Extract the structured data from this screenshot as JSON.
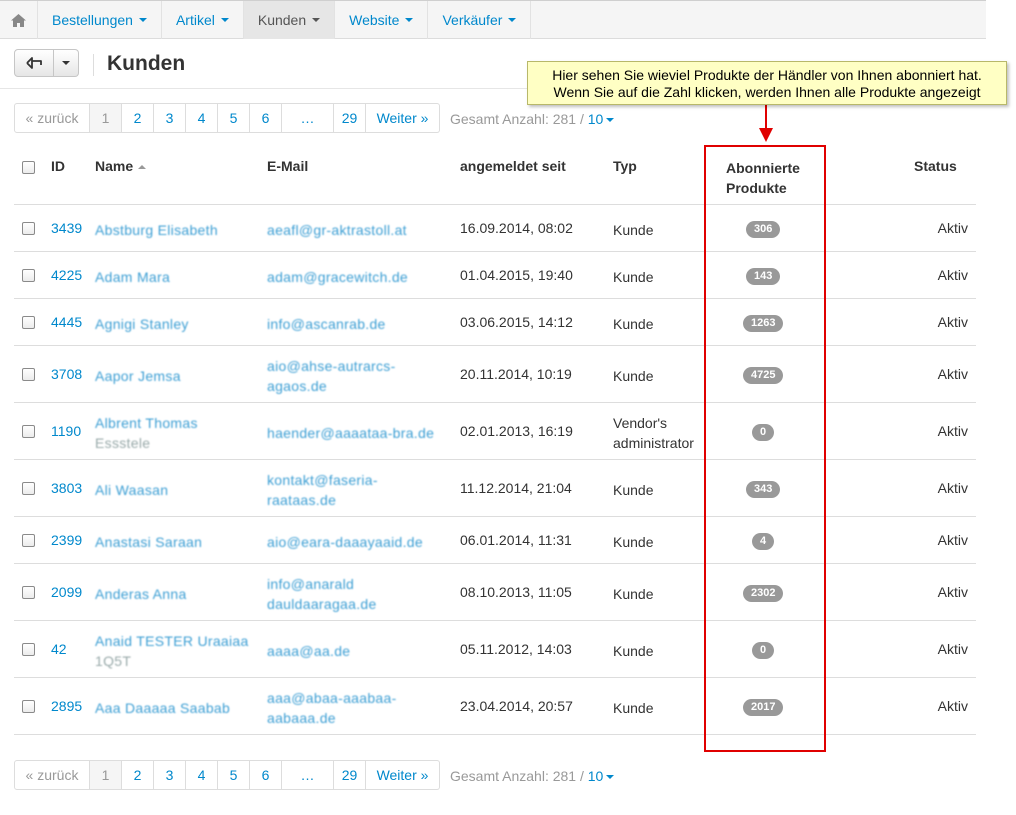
{
  "nav": {
    "home_icon": "home-icon",
    "items": [
      {
        "label": "Bestellungen"
      },
      {
        "label": "Artikel"
      },
      {
        "label": "Kunden"
      },
      {
        "label": "Website"
      },
      {
        "label": "Verkäufer"
      }
    ]
  },
  "header": {
    "back_icon": "arrow-left-icon",
    "title": "Kunden"
  },
  "callout": {
    "line1": "Hier sehen Sie wieviel Produkte der Händler von Ihnen abonniert hat.",
    "line2": "Wenn Sie auf die Zahl klicken, werden Ihnen alle Produkte angezeigt",
    "highlight_color": "#e00000",
    "background_color": "#ffffc4"
  },
  "pagination": {
    "prev": "« zurück",
    "pages": [
      "1",
      "2",
      "3",
      "4",
      "5",
      "6",
      "…",
      "29"
    ],
    "current": "1",
    "next": "Weiter »",
    "total_label": "Gesamt Anzahl: 281 /",
    "per_page": "10"
  },
  "table": {
    "columns": {
      "id": "ID",
      "name": "Name",
      "email": "E-Mail",
      "registered": "angemeldet seit",
      "type": "Typ",
      "subscribed": "Abonnierte Produkte",
      "status": "Status"
    },
    "rows": [
      {
        "id": "3439",
        "name": "Abstburg Elisabeth",
        "name2": "",
        "email": "aeafl@gr-aktrastoll.at",
        "email2": "",
        "date": "16.09.2014, 08:02",
        "type": "Kunde",
        "type2": "",
        "count": "306",
        "status": "Aktiv"
      },
      {
        "id": "4225",
        "name": "Adam Mara",
        "name2": "",
        "email": "adam@gracewitch.de",
        "email2": "",
        "date": "01.04.2015, 19:40",
        "type": "Kunde",
        "type2": "",
        "count": "143",
        "status": "Aktiv"
      },
      {
        "id": "4445",
        "name": "Agnigi Stanley",
        "name2": "",
        "email": "info@ascanrab.de",
        "email2": "",
        "date": "03.06.2015, 14:12",
        "type": "Kunde",
        "type2": "",
        "count": "1263",
        "status": "Aktiv"
      },
      {
        "id": "3708",
        "name": "Aapor Jemsa",
        "name2": "",
        "email": "aio@ahse-autrarcs-",
        "email2": "agaos.de",
        "date": "20.11.2014, 10:19",
        "type": "Kunde",
        "type2": "",
        "count": "4725",
        "status": "Aktiv"
      },
      {
        "id": "1190",
        "name": "Albrent Thomas",
        "name2": "Essstele",
        "email": "haender@aaaataa-bra.de",
        "email2": "",
        "date": "02.01.2013, 16:19",
        "type": "Vendor's",
        "type2": "administrator",
        "count": "0",
        "status": "Aktiv"
      },
      {
        "id": "3803",
        "name": "Ali Waasan",
        "name2": "",
        "email": "kontakt@faseria-",
        "email2": "raataas.de",
        "date": "11.12.2014, 21:04",
        "type": "Kunde",
        "type2": "",
        "count": "343",
        "status": "Aktiv"
      },
      {
        "id": "2399",
        "name": "Anastasi Saraan",
        "name2": "",
        "email": "aio@eara-daaayaaid.de",
        "email2": "",
        "date": "06.01.2014, 11:31",
        "type": "Kunde",
        "type2": "",
        "count": "4",
        "status": "Aktiv"
      },
      {
        "id": "2099",
        "name": "Anderas Anna",
        "name2": "",
        "email": "info@anarald",
        "email2": "dauldaaragaa.de",
        "date": "08.10.2013, 11:05",
        "type": "Kunde",
        "type2": "",
        "count": "2302",
        "status": "Aktiv"
      },
      {
        "id": "42",
        "name": "Anaid TESTER Uraaiaa",
        "name2": "1Q5T",
        "email": "aaaa@aa.de",
        "email2": "",
        "date": "05.11.2012, 14:03",
        "type": "Kunde",
        "type2": "",
        "count": "0",
        "status": "Aktiv"
      },
      {
        "id": "2895",
        "name": "Aaa Daaaaa Saabab",
        "name2": "",
        "email": "aaa@abaa-aaabaa-",
        "email2": "aabaaa.de",
        "date": "23.04.2014, 20:57",
        "type": "Kunde",
        "type2": "",
        "count": "2017",
        "status": "Aktiv"
      }
    ]
  }
}
